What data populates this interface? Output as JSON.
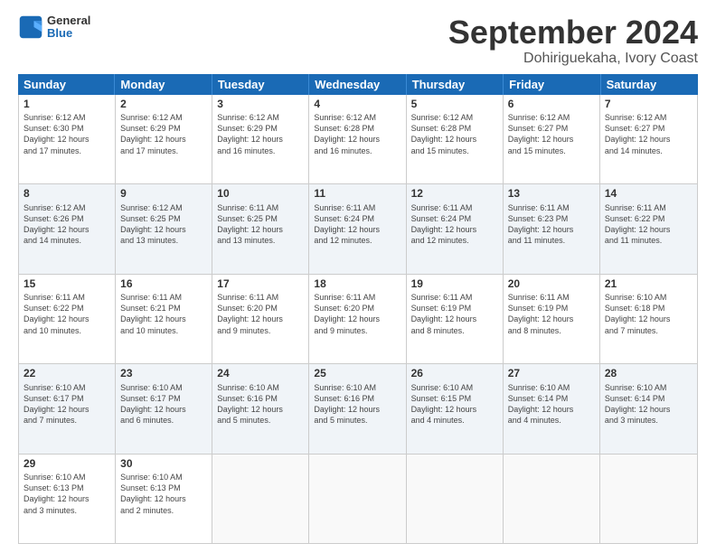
{
  "logo": {
    "text_general": "General",
    "text_blue": "Blue"
  },
  "title": "September 2024",
  "subtitle": "Dohiriguekaha, Ivory Coast",
  "header_days": [
    "Sunday",
    "Monday",
    "Tuesday",
    "Wednesday",
    "Thursday",
    "Friday",
    "Saturday"
  ],
  "weeks": [
    {
      "shaded": false,
      "cells": [
        {
          "day": "1",
          "info": "Sunrise: 6:12 AM\nSunset: 6:30 PM\nDaylight: 12 hours\nand 17 minutes."
        },
        {
          "day": "2",
          "info": "Sunrise: 6:12 AM\nSunset: 6:29 PM\nDaylight: 12 hours\nand 17 minutes."
        },
        {
          "day": "3",
          "info": "Sunrise: 6:12 AM\nSunset: 6:29 PM\nDaylight: 12 hours\nand 16 minutes."
        },
        {
          "day": "4",
          "info": "Sunrise: 6:12 AM\nSunset: 6:28 PM\nDaylight: 12 hours\nand 16 minutes."
        },
        {
          "day": "5",
          "info": "Sunrise: 6:12 AM\nSunset: 6:28 PM\nDaylight: 12 hours\nand 15 minutes."
        },
        {
          "day": "6",
          "info": "Sunrise: 6:12 AM\nSunset: 6:27 PM\nDaylight: 12 hours\nand 15 minutes."
        },
        {
          "day": "7",
          "info": "Sunrise: 6:12 AM\nSunset: 6:27 PM\nDaylight: 12 hours\nand 14 minutes."
        }
      ]
    },
    {
      "shaded": true,
      "cells": [
        {
          "day": "8",
          "info": "Sunrise: 6:12 AM\nSunset: 6:26 PM\nDaylight: 12 hours\nand 14 minutes."
        },
        {
          "day": "9",
          "info": "Sunrise: 6:12 AM\nSunset: 6:25 PM\nDaylight: 12 hours\nand 13 minutes."
        },
        {
          "day": "10",
          "info": "Sunrise: 6:11 AM\nSunset: 6:25 PM\nDaylight: 12 hours\nand 13 minutes."
        },
        {
          "day": "11",
          "info": "Sunrise: 6:11 AM\nSunset: 6:24 PM\nDaylight: 12 hours\nand 12 minutes."
        },
        {
          "day": "12",
          "info": "Sunrise: 6:11 AM\nSunset: 6:24 PM\nDaylight: 12 hours\nand 12 minutes."
        },
        {
          "day": "13",
          "info": "Sunrise: 6:11 AM\nSunset: 6:23 PM\nDaylight: 12 hours\nand 11 minutes."
        },
        {
          "day": "14",
          "info": "Sunrise: 6:11 AM\nSunset: 6:22 PM\nDaylight: 12 hours\nand 11 minutes."
        }
      ]
    },
    {
      "shaded": false,
      "cells": [
        {
          "day": "15",
          "info": "Sunrise: 6:11 AM\nSunset: 6:22 PM\nDaylight: 12 hours\nand 10 minutes."
        },
        {
          "day": "16",
          "info": "Sunrise: 6:11 AM\nSunset: 6:21 PM\nDaylight: 12 hours\nand 10 minutes."
        },
        {
          "day": "17",
          "info": "Sunrise: 6:11 AM\nSunset: 6:20 PM\nDaylight: 12 hours\nand 9 minutes."
        },
        {
          "day": "18",
          "info": "Sunrise: 6:11 AM\nSunset: 6:20 PM\nDaylight: 12 hours\nand 9 minutes."
        },
        {
          "day": "19",
          "info": "Sunrise: 6:11 AM\nSunset: 6:19 PM\nDaylight: 12 hours\nand 8 minutes."
        },
        {
          "day": "20",
          "info": "Sunrise: 6:11 AM\nSunset: 6:19 PM\nDaylight: 12 hours\nand 8 minutes."
        },
        {
          "day": "21",
          "info": "Sunrise: 6:10 AM\nSunset: 6:18 PM\nDaylight: 12 hours\nand 7 minutes."
        }
      ]
    },
    {
      "shaded": true,
      "cells": [
        {
          "day": "22",
          "info": "Sunrise: 6:10 AM\nSunset: 6:17 PM\nDaylight: 12 hours\nand 7 minutes."
        },
        {
          "day": "23",
          "info": "Sunrise: 6:10 AM\nSunset: 6:17 PM\nDaylight: 12 hours\nand 6 minutes."
        },
        {
          "day": "24",
          "info": "Sunrise: 6:10 AM\nSunset: 6:16 PM\nDaylight: 12 hours\nand 5 minutes."
        },
        {
          "day": "25",
          "info": "Sunrise: 6:10 AM\nSunset: 6:16 PM\nDaylight: 12 hours\nand 5 minutes."
        },
        {
          "day": "26",
          "info": "Sunrise: 6:10 AM\nSunset: 6:15 PM\nDaylight: 12 hours\nand 4 minutes."
        },
        {
          "day": "27",
          "info": "Sunrise: 6:10 AM\nSunset: 6:14 PM\nDaylight: 12 hours\nand 4 minutes."
        },
        {
          "day": "28",
          "info": "Sunrise: 6:10 AM\nSunset: 6:14 PM\nDaylight: 12 hours\nand 3 minutes."
        }
      ]
    },
    {
      "shaded": false,
      "cells": [
        {
          "day": "29",
          "info": "Sunrise: 6:10 AM\nSunset: 6:13 PM\nDaylight: 12 hours\nand 3 minutes."
        },
        {
          "day": "30",
          "info": "Sunrise: 6:10 AM\nSunset: 6:13 PM\nDaylight: 12 hours\nand 2 minutes."
        },
        {
          "day": "",
          "info": ""
        },
        {
          "day": "",
          "info": ""
        },
        {
          "day": "",
          "info": ""
        },
        {
          "day": "",
          "info": ""
        },
        {
          "day": "",
          "info": ""
        }
      ]
    }
  ]
}
